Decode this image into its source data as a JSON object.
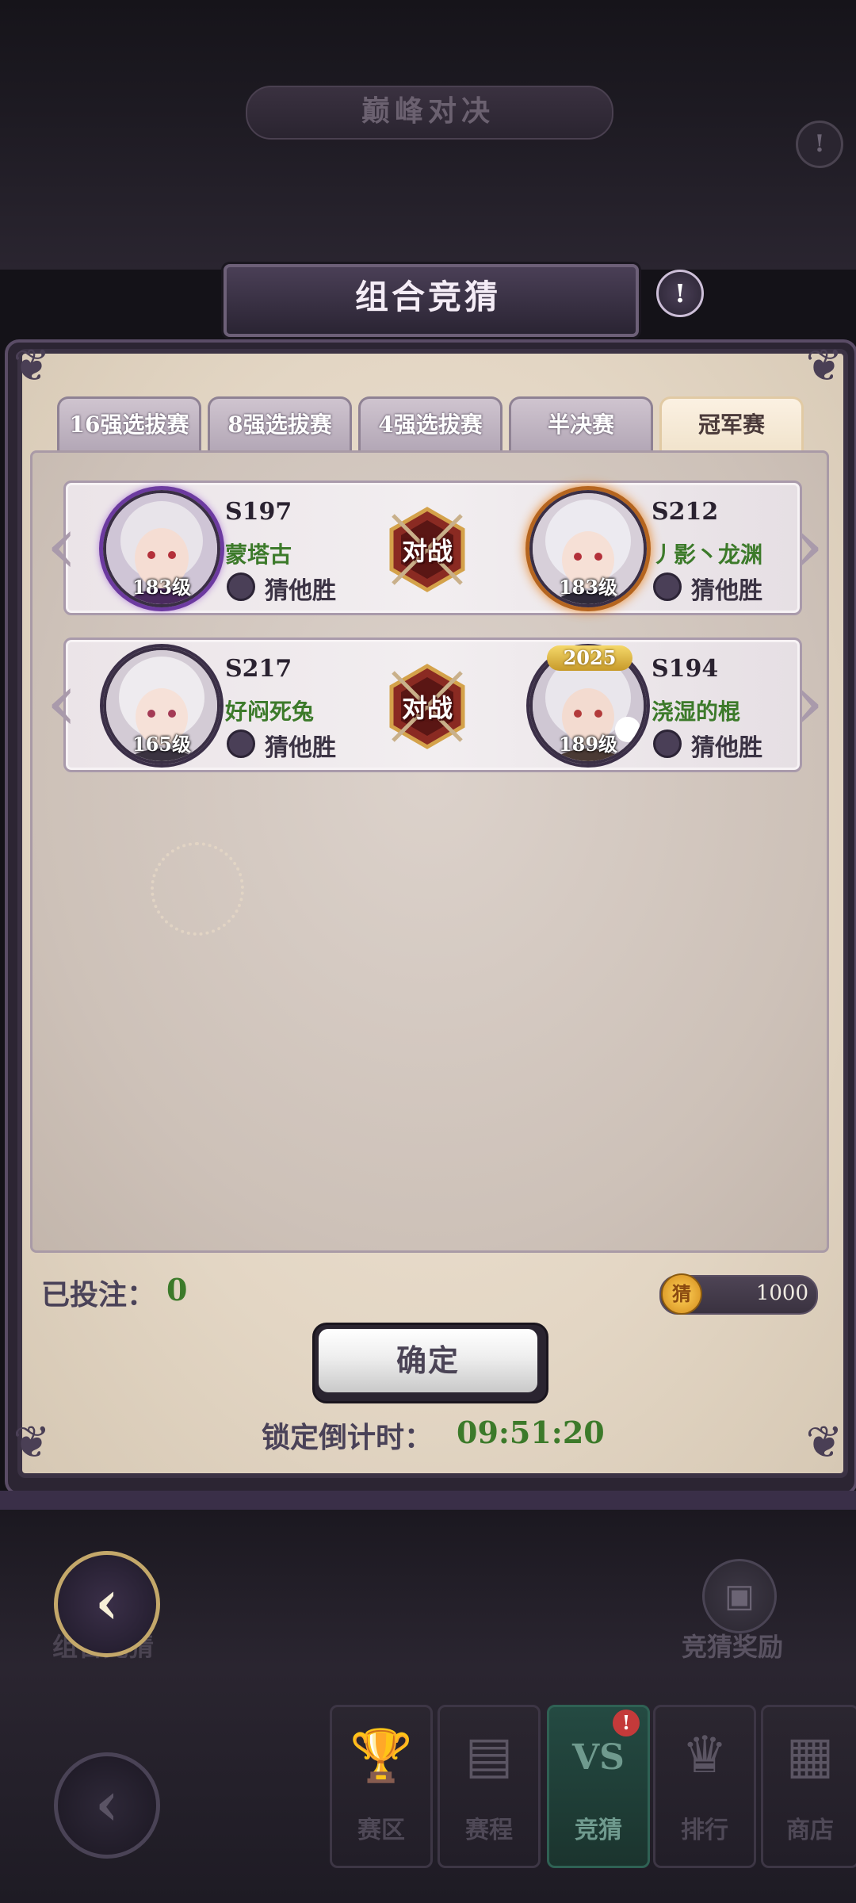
{
  "background": {
    "title": "巅峰对决"
  },
  "modal": {
    "title": "组合竞猜",
    "tabs": [
      "16强选拔赛",
      "8强选拔赛",
      "4强选拔赛",
      "半决赛",
      "冠军赛"
    ],
    "active_tab": "冠军赛",
    "matches": [
      {
        "vs_label": "对战",
        "left": {
          "server": "S197",
          "name": "蒙塔古",
          "level": "183级",
          "guess_label": "猜他胜"
        },
        "right": {
          "server": "S212",
          "name": "丿影丶龙渊",
          "level": "183级",
          "guess_label": "猜他胜"
        }
      },
      {
        "vs_label": "对战",
        "left": {
          "server": "S217",
          "name": "好闷死兔",
          "level": "165级",
          "guess_label": "猜他胜"
        },
        "right": {
          "server": "S194",
          "name": "浇湿的棍",
          "level": "189级",
          "guess_label": "猜他胜",
          "badge": "2025"
        }
      }
    ],
    "bet_label": "已投注：",
    "bet_value": "0",
    "coin_icon_text": "猜",
    "coin_balance": "1000",
    "confirm_label": "确定",
    "countdown_label": "锁定倒计时：",
    "countdown_value": "09:51:20"
  },
  "bottom": {
    "left_label": "组合竞猜",
    "reward_label": "竞猜奖励",
    "nav": [
      {
        "label": "赛区",
        "icon": "trophy-icon"
      },
      {
        "label": "赛程",
        "icon": "schedule-icon"
      },
      {
        "label": "竞猜",
        "icon": "vs-icon",
        "icon_text": "VS",
        "active": true
      },
      {
        "label": "排行",
        "icon": "crown-icon"
      },
      {
        "label": "商店",
        "icon": "shop-icon"
      }
    ],
    "notification_badge": "!"
  },
  "colors": {
    "accent_green": "#3c7a2a",
    "modal_frame": "#2c2533",
    "parchment": "#e3d6c4"
  }
}
